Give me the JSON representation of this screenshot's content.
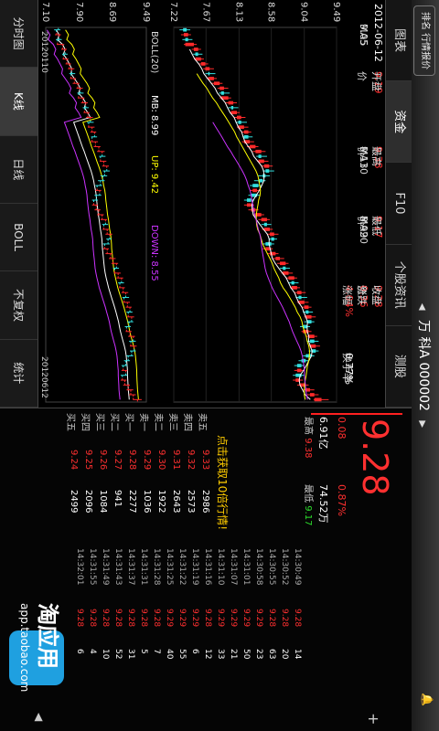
{
  "header": {
    "title": "万 科A 000002",
    "left_button": "排名 行情报价",
    "prev_icon": "◀",
    "next_icon": "▶"
  },
  "tabs": [
    "图表",
    "资金",
    "F10",
    "个股资讯",
    "测股"
  ],
  "info": {
    "date": "2012-06-12",
    "open_label": "开盘价 ",
    "open": "9.19",
    "high_label": "最高价 ",
    "high": "9.38",
    "low_label": "最低价 ",
    "low": "9.17",
    "close_label": "收盘价 ",
    "close": "9.28",
    "change_label": "涨跌 ",
    "change": "0.36",
    "pct_label": "涨幅 ",
    "pct": "4.04%",
    "turnover_label": "换手率 ",
    "turnover": "0.77%"
  },
  "ma": {
    "ma5_label": "MA5 ",
    "ma5": "9.05",
    "ma10_label": "MA10 ",
    "ma10": "9.13",
    "ma20_label": "MA20 ",
    "ma20": "8.99"
  },
  "boll": {
    "label": "BOLL(20)",
    "mb_label": "MB: ",
    "mb": "8.99",
    "up_label": "UP: ",
    "up": "9.42",
    "down_label": "DOWN: ",
    "down": "8.55"
  },
  "price_axis": [
    "9.49",
    "9.04",
    "8.58",
    "8.13",
    "7.67",
    "7.22"
  ],
  "lower_axis": [
    "9.49",
    "8.69",
    "7.90",
    "7.10"
  ],
  "date_start": "20120110",
  "date_end": "20120612",
  "bottom_tabs": [
    "分时图",
    "K线",
    "日线",
    "BOLL",
    "不复权",
    "统计"
  ],
  "quote": {
    "price": "9.28",
    "change": "0.08",
    "pct": "0.87%",
    "amount": "6.91亿",
    "volume": "74.52万",
    "high_label": "最高",
    "high": "9.38",
    "low_label": "最低",
    "low": "9.17",
    "ad_text": "点击获取10倍行情!"
  },
  "orderbook": [
    {
      "label": "卖五",
      "price": "9.33",
      "vol": "2986"
    },
    {
      "label": "卖四",
      "price": "9.32",
      "vol": "2573"
    },
    {
      "label": "卖三",
      "price": "9.31",
      "vol": "2643"
    },
    {
      "label": "卖二",
      "price": "9.30",
      "vol": "1922"
    },
    {
      "label": "卖一",
      "price": "9.29",
      "vol": "1036"
    },
    {
      "label": "买一",
      "price": "9.28",
      "vol": "2277"
    },
    {
      "label": "买二",
      "price": "9.27",
      "vol": "941"
    },
    {
      "label": "买三",
      "price": "9.26",
      "vol": "1084"
    },
    {
      "label": "买四",
      "price": "9.25",
      "vol": "2096"
    },
    {
      "label": "买五",
      "price": "9.24",
      "vol": "2499"
    }
  ],
  "ticks": [
    {
      "time": "14:30:49",
      "price": "9.28",
      "vol": "14"
    },
    {
      "time": "14:30:52",
      "price": "9.28",
      "vol": "20"
    },
    {
      "time": "14:30:55",
      "price": "9.28",
      "vol": "63"
    },
    {
      "time": "14:30:58",
      "price": "9.29",
      "vol": "23"
    },
    {
      "time": "14:31:01",
      "price": "9.29",
      "vol": "50"
    },
    {
      "time": "14:31:07",
      "price": "9.29",
      "vol": "21"
    },
    {
      "time": "14:31:10",
      "price": "9.29",
      "vol": "33"
    },
    {
      "time": "14:31:16",
      "price": "9.28",
      "vol": "12"
    },
    {
      "time": "14:31:19",
      "price": "9.29",
      "vol": "6"
    },
    {
      "time": "14:31:22",
      "price": "9.29",
      "vol": "55"
    },
    {
      "time": "14:31:25",
      "price": "9.29",
      "vol": "40"
    },
    {
      "time": "14:31:28",
      "price": "9.28",
      "vol": "7"
    },
    {
      "time": "14:31:31",
      "price": "9.28",
      "vol": "5"
    },
    {
      "time": "14:31:37",
      "price": "9.28",
      "vol": "31"
    },
    {
      "time": "14:31:43",
      "price": "9.28",
      "vol": "52"
    },
    {
      "time": "14:31:49",
      "price": "9.28",
      "vol": "10"
    },
    {
      "time": "14:31:55",
      "price": "9.28",
      "vol": "4"
    },
    {
      "time": "14:32:01",
      "price": "9.28",
      "vol": "6"
    }
  ],
  "watermark": {
    "name": "淘应用",
    "url": "app.taobao.com"
  },
  "colors": {
    "up": "#ff2a2a",
    "down": "#33e0e0",
    "ma5": "#ffffff",
    "ma10": "#ffff00",
    "ma20": "#cc33ff",
    "ma_green": "#22cc22"
  },
  "chart_data": {
    "type": "candlestick",
    "title": "",
    "y_ticks": [
      "9.49",
      "9.04",
      "8.58",
      "8.13",
      "7.67",
      "7.22"
    ],
    "ylim": [
      7.22,
      9.49
    ],
    "x_start": "20120110",
    "x_end": "20120612",
    "candles": [
      [
        7.4,
        7.35,
        7.45,
        7.3
      ],
      [
        7.36,
        7.42,
        7.46,
        7.32
      ],
      [
        7.42,
        7.38,
        7.48,
        7.34
      ],
      [
        7.38,
        7.5,
        7.54,
        7.36
      ],
      [
        7.5,
        7.56,
        7.6,
        7.47
      ],
      [
        7.56,
        7.52,
        7.62,
        7.49
      ],
      [
        7.52,
        7.6,
        7.64,
        7.5
      ],
      [
        7.6,
        7.66,
        7.7,
        7.57
      ],
      [
        7.66,
        7.72,
        7.78,
        7.63
      ],
      [
        7.72,
        7.7,
        7.8,
        7.66
      ],
      [
        7.7,
        7.78,
        7.82,
        7.68
      ],
      [
        7.78,
        7.86,
        7.9,
        7.74
      ],
      [
        7.86,
        7.92,
        7.98,
        7.83
      ],
      [
        7.92,
        7.88,
        8.0,
        7.85
      ],
      [
        7.88,
        7.98,
        8.02,
        7.86
      ],
      [
        7.98,
        8.05,
        8.1,
        7.94
      ],
      [
        8.05,
        8.02,
        8.12,
        7.98
      ],
      [
        8.02,
        8.1,
        8.14,
        8.0
      ],
      [
        8.1,
        8.16,
        8.22,
        8.06
      ],
      [
        8.16,
        8.12,
        8.24,
        8.08
      ],
      [
        8.12,
        8.2,
        8.26,
        8.1
      ],
      [
        8.2,
        8.26,
        8.3,
        8.16
      ],
      [
        8.26,
        8.2,
        8.32,
        8.18
      ],
      [
        8.2,
        8.28,
        8.34,
        8.17
      ],
      [
        8.28,
        8.36,
        8.4,
        8.24
      ],
      [
        8.36,
        8.44,
        8.5,
        8.32
      ],
      [
        8.44,
        8.4,
        8.52,
        8.37
      ],
      [
        8.4,
        8.48,
        8.54,
        8.38
      ],
      [
        8.48,
        8.55,
        8.6,
        8.44
      ],
      [
        8.55,
        8.5,
        8.62,
        8.46
      ],
      [
        8.5,
        8.46,
        8.56,
        8.4
      ],
      [
        8.46,
        8.4,
        8.5,
        8.34
      ],
      [
        8.4,
        8.32,
        8.44,
        8.28
      ],
      [
        8.32,
        8.38,
        8.42,
        8.28
      ],
      [
        8.38,
        8.3,
        8.42,
        8.26
      ],
      [
        8.3,
        8.24,
        8.34,
        8.2
      ],
      [
        8.24,
        8.3,
        8.34,
        8.2
      ],
      [
        8.3,
        8.36,
        8.4,
        8.26
      ],
      [
        8.36,
        8.44,
        8.48,
        8.32
      ],
      [
        8.44,
        8.52,
        8.56,
        8.4
      ],
      [
        8.52,
        8.48,
        8.58,
        8.44
      ],
      [
        8.48,
        8.56,
        8.6,
        8.45
      ],
      [
        8.56,
        8.62,
        8.68,
        8.52
      ],
      [
        8.62,
        8.58,
        8.66,
        8.54
      ],
      [
        8.58,
        8.5,
        8.62,
        8.46
      ],
      [
        8.5,
        8.56,
        8.6,
        8.46
      ],
      [
        8.56,
        8.64,
        8.68,
        8.52
      ],
      [
        8.64,
        8.7,
        8.76,
        8.6
      ],
      [
        8.7,
        8.78,
        8.82,
        8.66
      ],
      [
        8.78,
        8.74,
        8.84,
        8.7
      ],
      [
        8.74,
        8.82,
        8.88,
        8.72
      ],
      [
        8.82,
        8.9,
        8.94,
        8.78
      ],
      [
        8.9,
        8.86,
        8.96,
        8.82
      ],
      [
        8.86,
        8.94,
        8.98,
        8.84
      ],
      [
        8.94,
        9.0,
        9.06,
        8.9
      ],
      [
        9.0,
        8.96,
        9.08,
        8.92
      ],
      [
        8.96,
        9.04,
        9.1,
        8.94
      ],
      [
        9.04,
        9.1,
        9.14,
        9.0
      ],
      [
        9.1,
        9.06,
        9.16,
        9.02
      ],
      [
        9.06,
        9.14,
        9.2,
        9.04
      ],
      [
        9.14,
        9.08,
        9.18,
        9.04
      ],
      [
        9.08,
        9.02,
        9.12,
        8.98
      ],
      [
        9.02,
        9.1,
        9.14,
        9.0
      ],
      [
        9.1,
        9.18,
        9.22,
        9.06
      ],
      [
        9.18,
        9.12,
        9.24,
        9.08
      ],
      [
        9.12,
        9.2,
        9.26,
        9.1
      ],
      [
        9.2,
        9.14,
        9.24,
        9.1
      ],
      [
        9.14,
        9.06,
        9.18,
        9.02
      ],
      [
        9.06,
        9.0,
        9.1,
        8.96
      ],
      [
        9.0,
        8.94,
        9.04,
        8.9
      ],
      [
        8.94,
        9.0,
        9.04,
        8.9
      ],
      [
        9.0,
        8.92,
        9.04,
        8.88
      ],
      [
        8.92,
        8.98,
        9.02,
        8.88
      ],
      [
        8.98,
        9.06,
        9.1,
        8.94
      ],
      [
        9.06,
        9.12,
        9.18,
        9.02
      ],
      [
        9.12,
        9.18,
        9.24,
        9.08
      ],
      [
        9.18,
        9.28,
        9.38,
        9.17
      ]
    ],
    "ma5_label": "MA5",
    "ma10_label": "MA10",
    "ma20_label": "MA20"
  }
}
